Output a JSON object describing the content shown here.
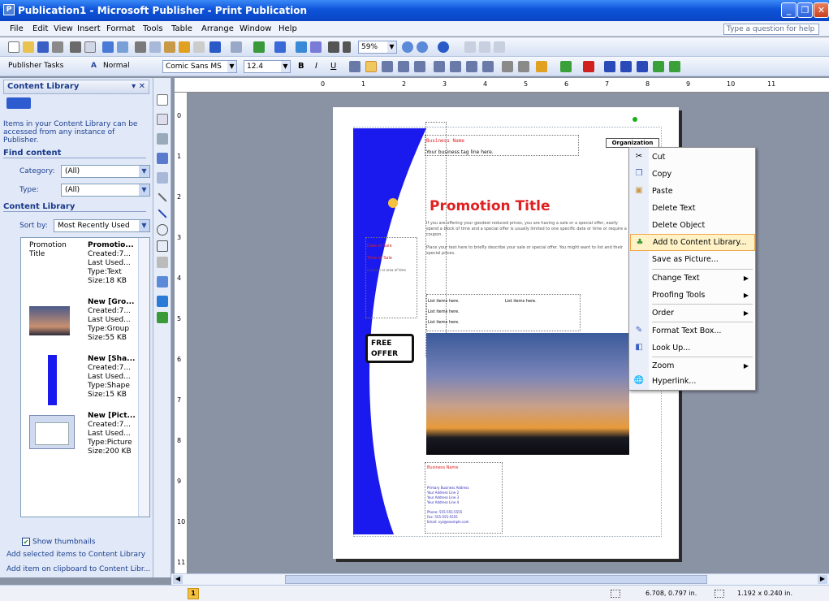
{
  "window": {
    "title": "Publication1 - Microsoft Publisher - Print Publication"
  },
  "menu": {
    "items": [
      "File",
      "Edit",
      "View",
      "Insert",
      "Format",
      "Tools",
      "Table",
      "Arrange",
      "Window",
      "Help"
    ],
    "ask": "Type a question for help"
  },
  "toolbar1": {
    "zoom": "59%"
  },
  "toolbar2": {
    "tasks": "Publisher Tasks",
    "style": "Normal",
    "font": "Comic Sans MS",
    "size": "12.4"
  },
  "taskpane": {
    "title": "Content Library",
    "description": "Items in your Content Library can be accessed from any instance of Publisher.",
    "find_header": "Find content",
    "category_label": "Category:",
    "category_value": "(All)",
    "type_label": "Type:",
    "type_value": "(All)",
    "library_header": "Content Library",
    "sortby_label": "Sort by:",
    "sortby_value": "Most Recently Used",
    "items": [
      {
        "thumb_label": "Promotion Title",
        "name": "Promotio...",
        "created": "Created:7...",
        "last": "Last Used...",
        "type": "Type:Text",
        "size": "Size:18 KB"
      },
      {
        "thumb_label": "",
        "name": "New [Gro...",
        "created": "Created:7...",
        "last": "Last Used...",
        "type": "Type:Group",
        "size": "Size:55 KB"
      },
      {
        "thumb_label": "",
        "name": "New [Sha...",
        "created": "Created:7...",
        "last": "Last Used...",
        "type": "Type:Shape",
        "size": "Size:15 KB"
      },
      {
        "thumb_label": "",
        "name": "New [Pict...",
        "created": "Created:7...",
        "last": "Last Used...",
        "type": "Type:Picture",
        "size": "Size:200 KB"
      }
    ],
    "show_thumbnails": "Show thumbnails",
    "add_selected": "Add selected items to Content Library",
    "add_clipboard": "Add item on clipboard to Content Libr..."
  },
  "ruler": {
    "top_numbers": [
      "0",
      "1",
      "2",
      "3",
      "4",
      "5",
      "6",
      "7",
      "8",
      "9",
      "10",
      "11"
    ],
    "left_numbers": [
      "0",
      "1",
      "2",
      "3",
      "4",
      "5",
      "6",
      "7",
      "8",
      "9",
      "10",
      "11"
    ]
  },
  "page": {
    "business_name": "Business Name",
    "tagline": "Your business tag line here.",
    "org_name": "Organization",
    "promo_title": "Promotion Title",
    "promo_body": "If you are offering your goodest reduced prices, you are having a sale or a special offer, easily spend a block of time and a special offer is usually limited to one specific date or time or require a coupon.",
    "promo_body2": "Place your text here to briefly describe your sale or special offer. You might want to list and their special prices.",
    "date_sale1": "Date of Sale",
    "date_sale2": "Time of Sale",
    "date_small": "Location or area of time",
    "list_items": [
      "List items here.",
      "List items here.",
      "List items here."
    ],
    "list_items2": [
      "List items here."
    ],
    "free_offer_1": "FREE",
    "free_offer_2": "OFFER",
    "footer_business": "Business Name",
    "footer_lines": [
      "Primary Business Address",
      "Your Address Line 2",
      "Your Address Line 3",
      "Your Address Line 4"
    ],
    "footer_lines2": [
      "Phone: 555-555-5555",
      "Fax: 555-555-5555",
      "Email: xyz@example.com"
    ]
  },
  "context_menu": {
    "items": [
      {
        "label": "Cut",
        "icon": "scissors-icon"
      },
      {
        "label": "Copy",
        "icon": "copy-icon"
      },
      {
        "label": "Paste",
        "icon": "paste-icon"
      },
      {
        "label": "Delete Text",
        "icon": ""
      },
      {
        "label": "Delete Object",
        "icon": ""
      },
      {
        "label": "Add to Content Library...",
        "icon": "content-library-icon"
      },
      {
        "label": "Save as Picture...",
        "icon": ""
      },
      {
        "label": "Change Text",
        "icon": ""
      },
      {
        "label": "Proofing Tools",
        "icon": ""
      },
      {
        "label": "Order",
        "icon": ""
      },
      {
        "label": "Format Text Box...",
        "icon": "format-icon"
      },
      {
        "label": "Look Up...",
        "icon": "lookup-icon"
      },
      {
        "label": "Zoom",
        "icon": ""
      },
      {
        "label": "Hyperlink...",
        "icon": "hyperlink-icon"
      }
    ]
  },
  "status": {
    "page_number": "1",
    "position": "6.708, 0.797 in.",
    "size": "1.192 x 0.240 in."
  }
}
